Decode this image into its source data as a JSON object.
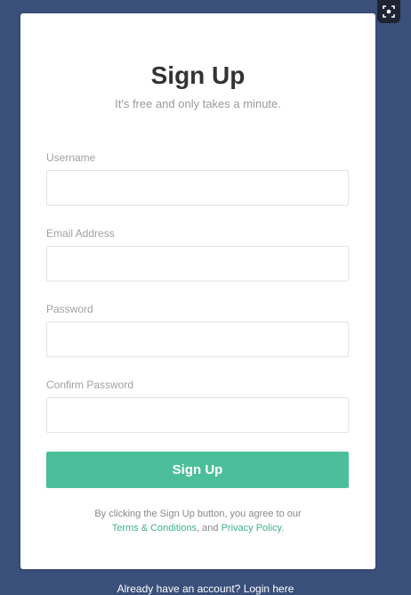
{
  "form": {
    "title": "Sign Up",
    "subtitle": "It's free and only takes a minute.",
    "fields": [
      {
        "label": "Username",
        "value": "",
        "placeholder": ""
      },
      {
        "label": "Email Address",
        "value": "",
        "placeholder": ""
      },
      {
        "label": "Password",
        "value": "",
        "placeholder": ""
      },
      {
        "label": "Confirm Password",
        "value": "",
        "placeholder": ""
      }
    ],
    "submit_label": "Sign Up",
    "terms_prefix": "By clicking the Sign Up button, you agree to our",
    "terms_link": "Terms & Conditions",
    "terms_and": ", and",
    "privacy_link": "Privacy Policy",
    "terms_suffix": "."
  },
  "footer": {
    "text": "Already have an account?",
    "login_link": "Login here"
  },
  "colors": {
    "background": "#3a4f7a",
    "accent": "#4cbf9a",
    "link": "#3fb08c"
  },
  "icons": {
    "corner": "screenshot-icon"
  }
}
